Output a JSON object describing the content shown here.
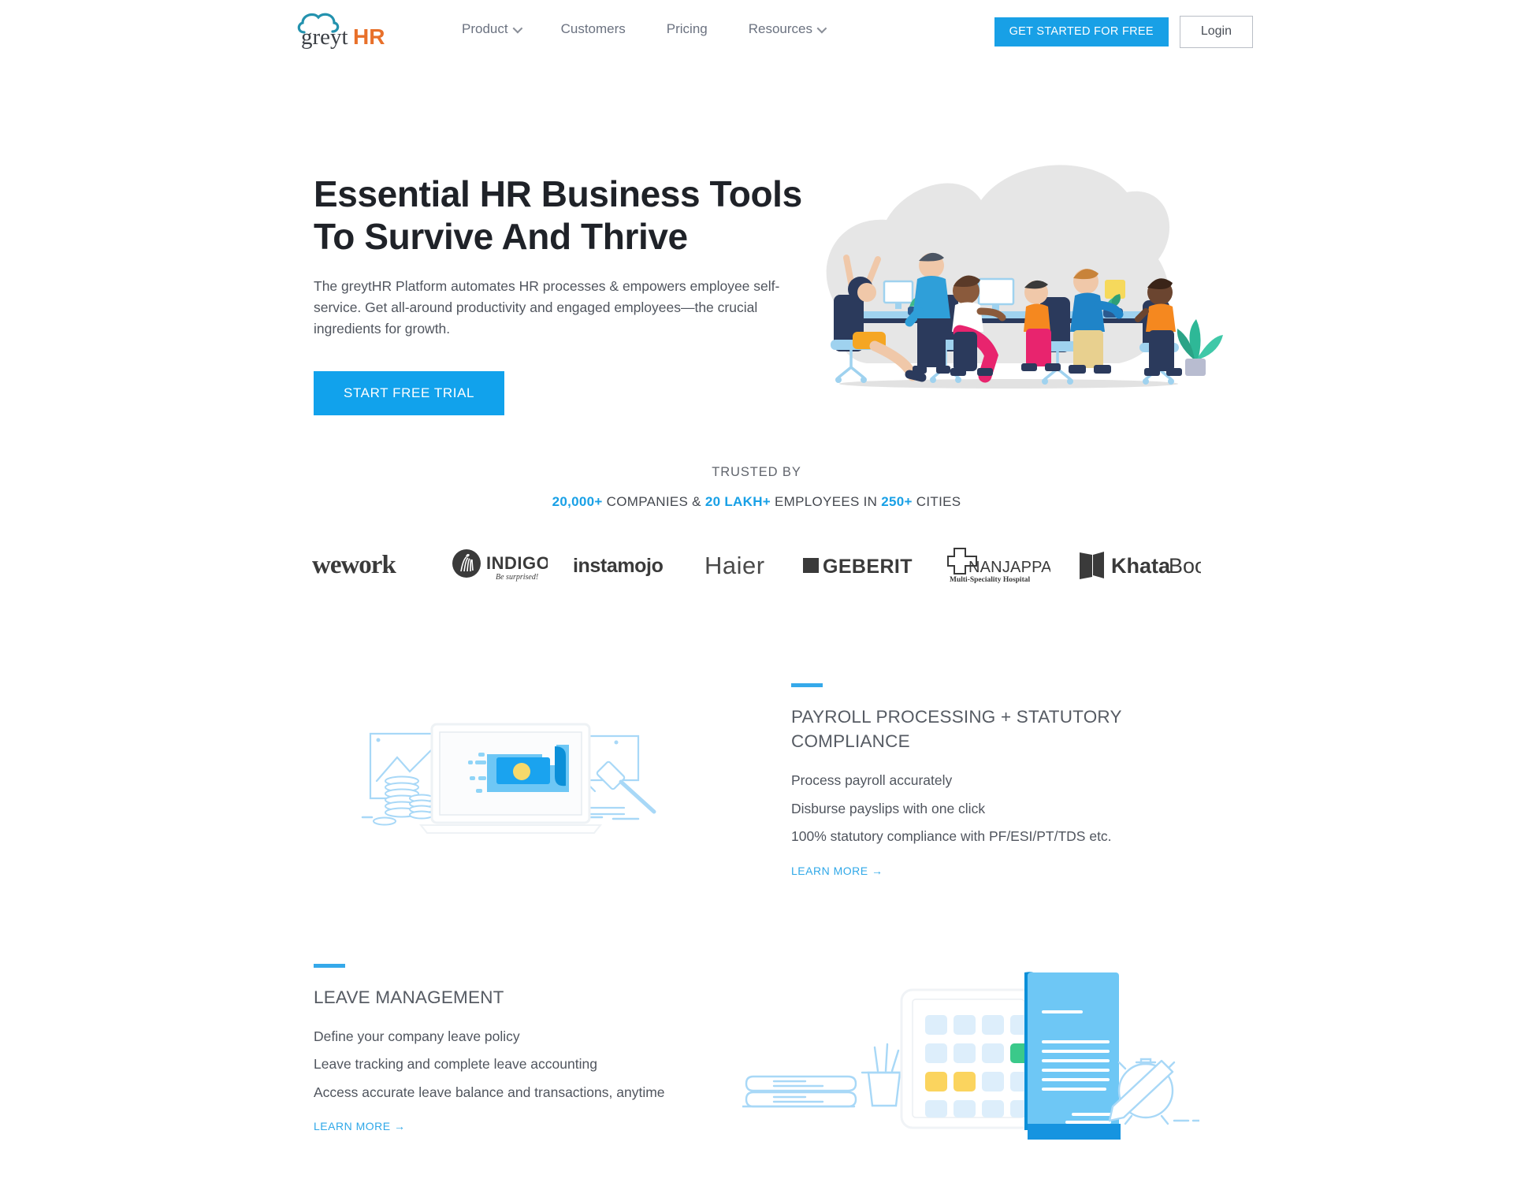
{
  "header": {
    "logo": {
      "name": "greytHR",
      "part1": "greyt",
      "part2": "HR"
    },
    "nav": [
      {
        "label": "Product",
        "has_caret": true
      },
      {
        "label": "Customers",
        "has_caret": false
      },
      {
        "label": "Pricing",
        "has_caret": false
      },
      {
        "label": "Resources",
        "has_caret": true
      }
    ],
    "cta_primary": "GET STARTED FOR FREE",
    "cta_login": "Login"
  },
  "hero": {
    "title_line1": "Essential HR Business Tools",
    "title_line2": "To Survive And Thrive",
    "subtitle": "The greytHR Platform automates HR processes & empowers employee self-service. Get all-around productivity and engaged employees—the crucial ingredients for growth.",
    "cta": "START FREE TRIAL",
    "illustration": "office-team-illustration"
  },
  "trusted": {
    "label": "TRUSTED BY",
    "stat_companies": "20,000+",
    "stat_companies_suffix": " COMPANIES & ",
    "stat_employees": "20 LAKH+",
    "stat_employees_suffix": " EMPLOYEES IN ",
    "stat_cities": "250+",
    "stat_cities_suffix": " CITIES",
    "logos": [
      {
        "name": "wework",
        "text": "wework"
      },
      {
        "name": "indigo",
        "text": "INDIGO",
        "tagline": "Be surprised!"
      },
      {
        "name": "instamojo",
        "text": "instamojo"
      },
      {
        "name": "haier",
        "text": "Haier"
      },
      {
        "name": "geberit",
        "text": "GEBERIT"
      },
      {
        "name": "nanjappa",
        "text": "NANJAPPA",
        "tagline": "Multi-Speciality Hospital"
      },
      {
        "name": "khatabook",
        "text": "KhataBook",
        "text_bold": "Khata",
        "text_light": "Book"
      }
    ]
  },
  "features": [
    {
      "id": "payroll",
      "title": "PAYROLL PROCESSING + STATUTORY COMPLIANCE",
      "bullets": [
        "Process payroll accurately",
        "Disburse payslips with one click",
        "100% statutory compliance with PF/ESI/PT/TDS etc."
      ],
      "link": "LEARN MORE",
      "link_arrow": "→",
      "illustration": "payroll-laptop-illustration"
    },
    {
      "id": "leave",
      "title": "LEAVE MANAGEMENT",
      "bullets": [
        "Define your company leave policy",
        "Leave tracking and complete leave accounting",
        "Access accurate leave balance and transactions, anytime"
      ],
      "link": "LEARN MORE",
      "link_arrow": "→",
      "illustration": "leave-calendar-illustration"
    }
  ],
  "colors": {
    "accent_blue": "#18a0e6",
    "cta_blue": "#11a2ec",
    "rule_blue": "#35a9ea",
    "text_dark": "#1f2228",
    "text_body": "#50555e",
    "logo_orange": "#E8702A",
    "logo_cloud": "#2392AE"
  }
}
